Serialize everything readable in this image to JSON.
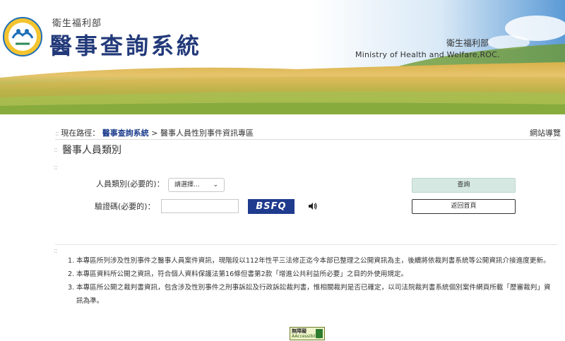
{
  "header": {
    "ministry_small": "衛生福利部",
    "system_title": "醫事查詢系統",
    "ministry_right": "衛生福利部",
    "ministry_en": "Ministry of Health and Welfare,ROC."
  },
  "breadcrumb": {
    "prefix": "現在路徑：",
    "link": "醫事查詢系統",
    "separator": ">",
    "current": "醫事人員性別事件資訊專區"
  },
  "sitemap_label": "網站導覽",
  "page_title": "醫事人員類別",
  "form": {
    "type_label": "人員類別(必要的)：",
    "type_selected": "請選擇...",
    "code_label": "驗證碼(必要的)：",
    "code_value": "",
    "captcha_text": "BSFQ",
    "query_button": "查詢",
    "home_button": "返回首頁"
  },
  "notes": [
    {
      "num": "1.",
      "text": "本專區所列涉及性別事件之醫事人員案件資訊，現階段以112年性平三法修正迄今本部已整理之公開資訊為主，後續將依裁判書系統等公開資訊介接進度更新。"
    },
    {
      "num": "2.",
      "text": "本專區資料所公開之資訊，符合個人資料保護法第16條但書第2款「增進公共利益所必要」之目的外使用規定。"
    },
    {
      "num": "3.",
      "text": "本專區所公開之裁判書資訊，包含涉及性別事件之刑事訴訟及行政訴訟裁判書，惟相關裁判是否已確定，以司法院裁判書系統個別案件網頁所載「歷審裁判」資訊為準。"
    }
  ],
  "accessibility_badge": {
    "line1": "無障礙",
    "line2": "AAccessibility"
  },
  "colors": {
    "title_blue": "#233a7a",
    "captcha_bg": "#1f3b8e",
    "query_btn_bg": "#d5e8e1",
    "link_blue": "#1f3f8f"
  },
  "icons": [
    "ministry-logo-icon",
    "speaker-icon",
    "chevron-down-icon"
  ]
}
